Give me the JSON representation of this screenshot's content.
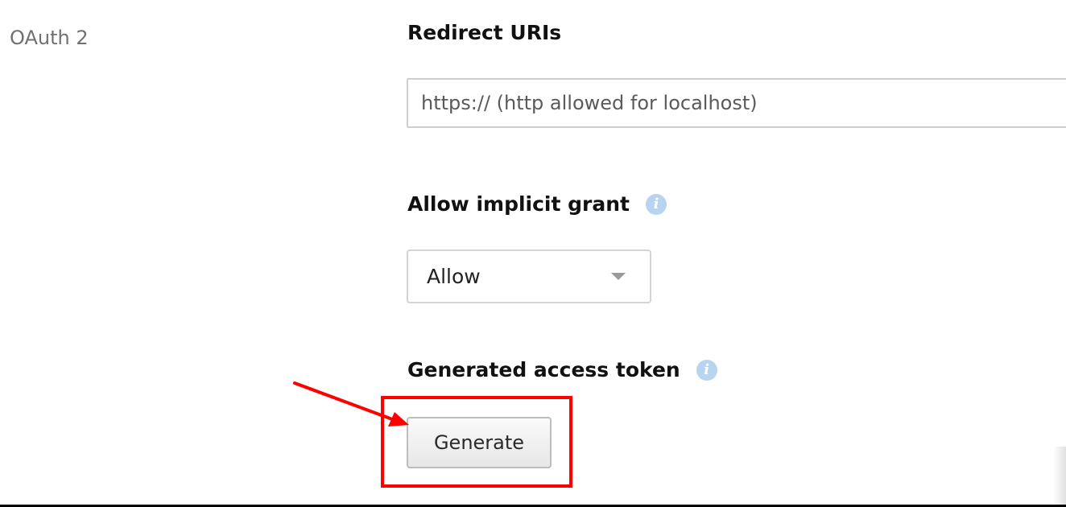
{
  "oauth": {
    "section_label": "OAuth 2",
    "redirect_uris": {
      "heading": "Redirect URIs",
      "placeholder": "https:// (http allowed for localhost)",
      "value": ""
    },
    "implicit_grant": {
      "heading": "Allow implicit grant",
      "info_icon": "info-icon",
      "selected": "Allow"
    },
    "access_token": {
      "heading": "Generated access token",
      "info_icon": "info-icon",
      "button_label": "Generate"
    }
  },
  "annotation": {
    "highlight_color": "#ff0000",
    "target": "Generate"
  },
  "colors": {
    "info_icon": "#b7d4f0",
    "section_label": "#707070",
    "highlight": "#ff0000"
  }
}
